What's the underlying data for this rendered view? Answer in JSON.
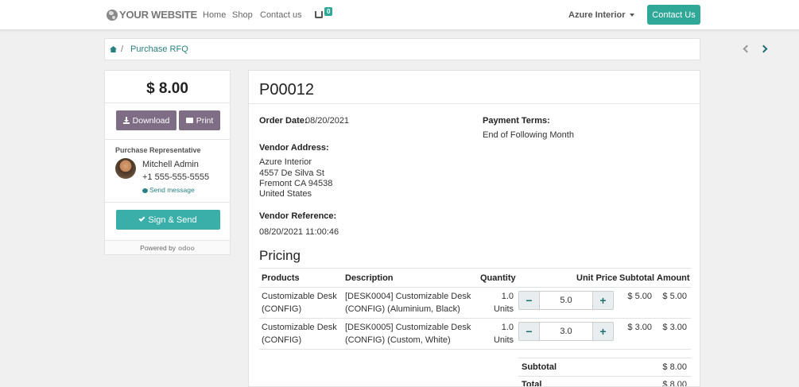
{
  "header": {
    "logo_text": "YOUR WEBSITE",
    "nav": [
      "Home",
      "Shop",
      "Contact us"
    ],
    "cart_count": "0",
    "user_menu": "Azure Interior",
    "contact_button": "Contact Us"
  },
  "breadcrumb": {
    "separator": "/",
    "current": "Purchase RFQ"
  },
  "sidebar": {
    "amount": "$ 8.00",
    "download_label": "Download",
    "print_label": "Print",
    "rep_title": "Purchase Representative",
    "rep_name": "Mitchell Admin",
    "rep_phone": "+1 555-555-5555",
    "send_message": "Send message",
    "sign_label": "Sign & Send",
    "powered_by": "Powered by",
    "powered_brand": "odoo"
  },
  "order": {
    "title": "P00012",
    "order_date_label": "Order Date:",
    "order_date": "08/20/2021",
    "payment_terms_label": "Payment Terms:",
    "payment_terms": "End of Following Month",
    "vendor_address_label": "Vendor Address:",
    "vendor_address": [
      "Azure Interior",
      "4557 De Silva St",
      "Fremont CA 94538",
      "United States"
    ],
    "vendor_reference_label": "Vendor Reference:",
    "vendor_reference": "08/20/2021 11:00:46"
  },
  "pricing": {
    "heading": "Pricing",
    "columns": [
      "Products",
      "Description",
      "Quantity",
      "Unit Price",
      "Subtotal",
      "Amount"
    ],
    "rows": [
      {
        "product": [
          "Customizable Desk",
          "(CONFIG)"
        ],
        "description": [
          "[DESK0004] Customizable Desk",
          "(CONFIG) (Aluminium, Black)"
        ],
        "quantity": [
          "1.0",
          "Units"
        ],
        "unit_price": "5.0",
        "subtotal": "$ 5.00",
        "amount": "$ 5.00"
      },
      {
        "product": [
          "Customizable Desk",
          "(CONFIG)"
        ],
        "description": [
          "[DESK0005] Customizable Desk",
          "(CONFIG) (Custom, White)"
        ],
        "quantity": [
          "1.0",
          "Units"
        ],
        "unit_price": "3.0",
        "subtotal": "$ 3.00",
        "amount": "$ 3.00"
      }
    ],
    "stepper_minus": "−",
    "stepper_plus": "+",
    "subtotal_label": "Subtotal",
    "subtotal_value": "$ 8.00",
    "total_label": "Total",
    "total_value": "$ 8.00"
  },
  "colors": {
    "accent": "#30a898",
    "button_secondary": "#7f6c85",
    "link": "#2a7f7f"
  }
}
